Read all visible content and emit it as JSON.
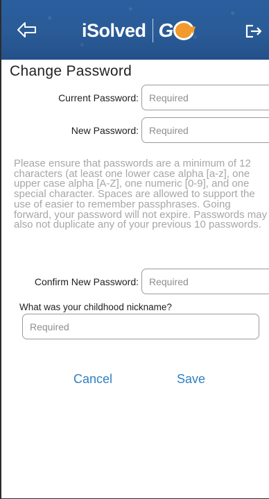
{
  "header": {
    "brand": "iSolved",
    "product": "GO",
    "back_icon": "back-arrow-icon",
    "logout_icon": "logout-icon",
    "brand_color": "#2a5b97",
    "accent_color": "#f29a2e"
  },
  "page": {
    "title": "Change Password"
  },
  "form": {
    "current_password": {
      "label": "Current Password:",
      "placeholder": "Required"
    },
    "new_password": {
      "label": "New Password:",
      "placeholder": "Required"
    },
    "help_text": "Please ensure that passwords are a minimum of 12 characters (at least one lower case alpha [a-z], one upper case alpha [A-Z], one numeric [0-9], and one special character. Spaces are allowed to support the use of easier to remember passphrases. Going forward, your password will not expire. Passwords may also not duplicate any of your previous 10 passwords.",
    "confirm_password": {
      "label": "Confirm New Password:",
      "placeholder": "Required"
    },
    "security_question": {
      "label": "What was your childhood nickname?",
      "placeholder": "Required"
    }
  },
  "actions": {
    "cancel_label": "Cancel",
    "save_label": "Save",
    "link_color": "#2f7fc2"
  }
}
